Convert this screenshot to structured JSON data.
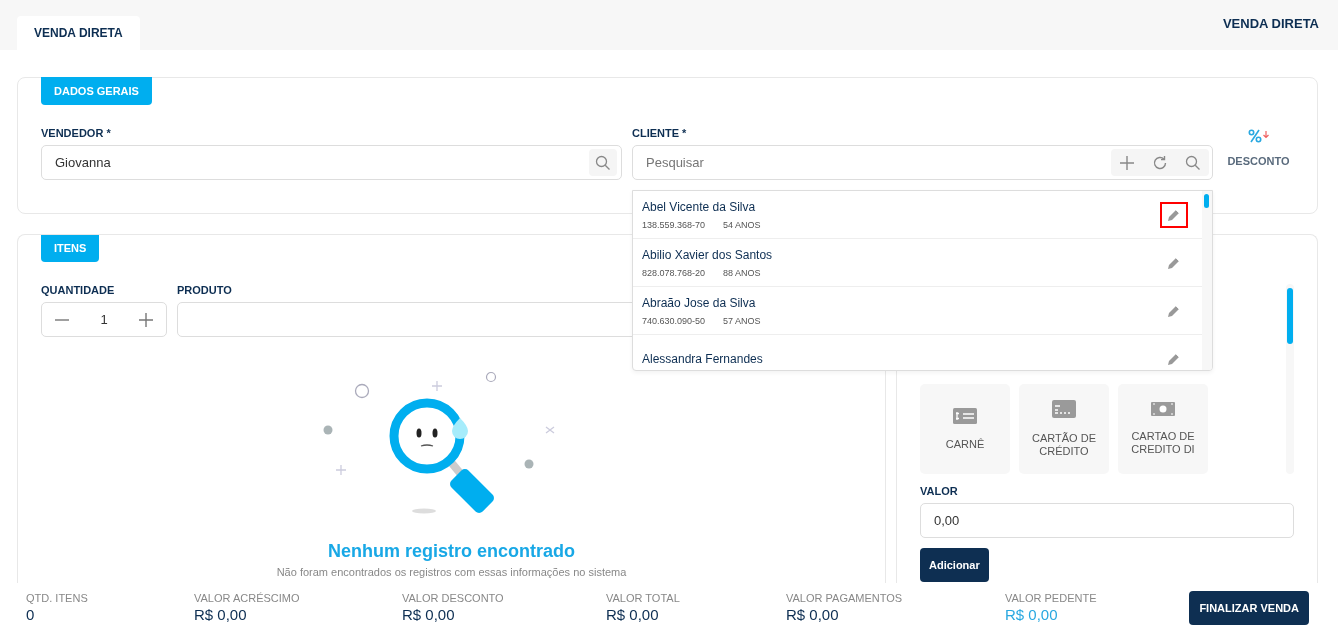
{
  "tabs": [
    {
      "label": "VENDA DIRETA",
      "selected": true
    }
  ],
  "page_title": "VENDA DIRETA",
  "general": {
    "badge": "DADOS GERAIS",
    "seller": {
      "label": "VENDEDOR *",
      "value": "Giovanna"
    },
    "client": {
      "label": "CLIENTE *",
      "placeholder": "Pesquisar"
    },
    "discount": {
      "label": "DESCONTO"
    }
  },
  "client_results": [
    {
      "name": "Abel Vicente da Silva",
      "cpf": "138.559.368-70",
      "age": "54 ANOS",
      "highlighted": true
    },
    {
      "name": "Abilio Xavier dos Santos",
      "cpf": "828.078.768-20",
      "age": "88 ANOS",
      "highlighted": false
    },
    {
      "name": "Abraão Jose da Silva",
      "cpf": "740.630.090-50",
      "age": "57 ANOS",
      "highlighted": false
    },
    {
      "name": "Alessandra Fernandes",
      "highlighted": false
    }
  ],
  "items": {
    "badge": "ITENS",
    "quantity": {
      "label": "QUANTIDADE",
      "value": "1"
    },
    "product": {
      "label": "PRODUTO"
    },
    "empty": {
      "title": "Nenhum registro encontrado",
      "message": "Não foram encontrados os registros com essas informações no sistema"
    }
  },
  "payment": {
    "methods": [
      {
        "kind": "carne",
        "label": "CARNÊ"
      },
      {
        "kind": "card",
        "label": "CARTÃO DE CRÉDITO"
      },
      {
        "kind": "cash",
        "label": "CARTAO DE CREDITO DI"
      }
    ],
    "value": {
      "label": "VALOR",
      "value": "0,00"
    },
    "add_button": "Adicionar"
  },
  "summary": [
    {
      "label": "QTD. ITENS",
      "value": "0",
      "highlight": false
    },
    {
      "label": "VALOR ACRÉSCIMO",
      "value": "R$ 0,00",
      "highlight": false
    },
    {
      "label": "VALOR DESCONTO",
      "value": "R$ 0,00",
      "highlight": false
    },
    {
      "label": "VALOR TOTAL",
      "value": "R$ 0,00",
      "highlight": false
    },
    {
      "label": "VALOR PAGAMENTOS",
      "value": "R$ 0,00",
      "highlight": false
    },
    {
      "label": "VALOR PEDENTE",
      "value": "R$ 0,00",
      "highlight": true
    }
  ],
  "finish_button": "FINALIZAR VENDA"
}
